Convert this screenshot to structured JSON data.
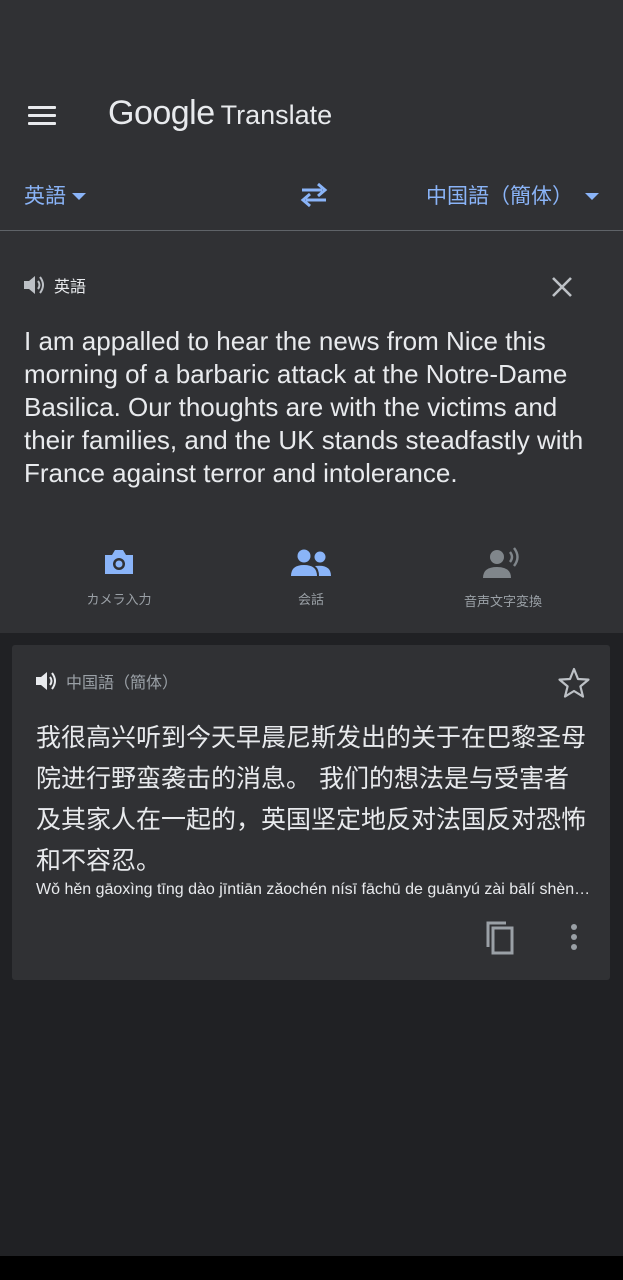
{
  "header": {
    "logo_google": "Google",
    "logo_translate": "Translate",
    "menu_icon": "hamburger-menu-icon"
  },
  "language_bar": {
    "source_language": "英語",
    "target_language": "中国語（簡体）",
    "swap_icon": "swap-arrows-icon"
  },
  "source": {
    "language_label": "英語",
    "text": "I am appalled to hear the news from Nice this morning of a barbaric attack at the Notre-Dame Basilica. Our thoughts are with the victims and their families, and the UK stands steadfastly with France against terror and intolerance.",
    "input_tools": [
      {
        "label": "カメラ入力",
        "icon": "camera-icon",
        "enabled": true
      },
      {
        "label": "会話",
        "icon": "people-icon",
        "enabled": true
      },
      {
        "label": "音声文字変換",
        "icon": "voice-person-icon",
        "enabled": false
      }
    ]
  },
  "result": {
    "language_label": "中国語（簡体）",
    "text": "我很高兴听到今天早晨尼斯发出的关于在巴黎圣母院进行野蛮袭击的消息。 我们的想法是与受害者及其家人在一起的，英国坚定地反对法国反对恐怖和不容忍。",
    "transliteration": "Wǒ hěn gāoxìng tīng dào jīntiān zǎochén nísī fāchū de guānyú zài bālí shèngmǔ yuàn jìnxíng yěmán xíjí de xiāoxī.",
    "star_icon": "star-outline-icon",
    "copy_icon": "copy-icon",
    "more_icon": "more-vertical-icon"
  },
  "colors": {
    "background": "#202124",
    "surface": "#303134",
    "accent": "#8ab4f8",
    "text": "#e8eaed",
    "muted": "#9aa0a6"
  }
}
